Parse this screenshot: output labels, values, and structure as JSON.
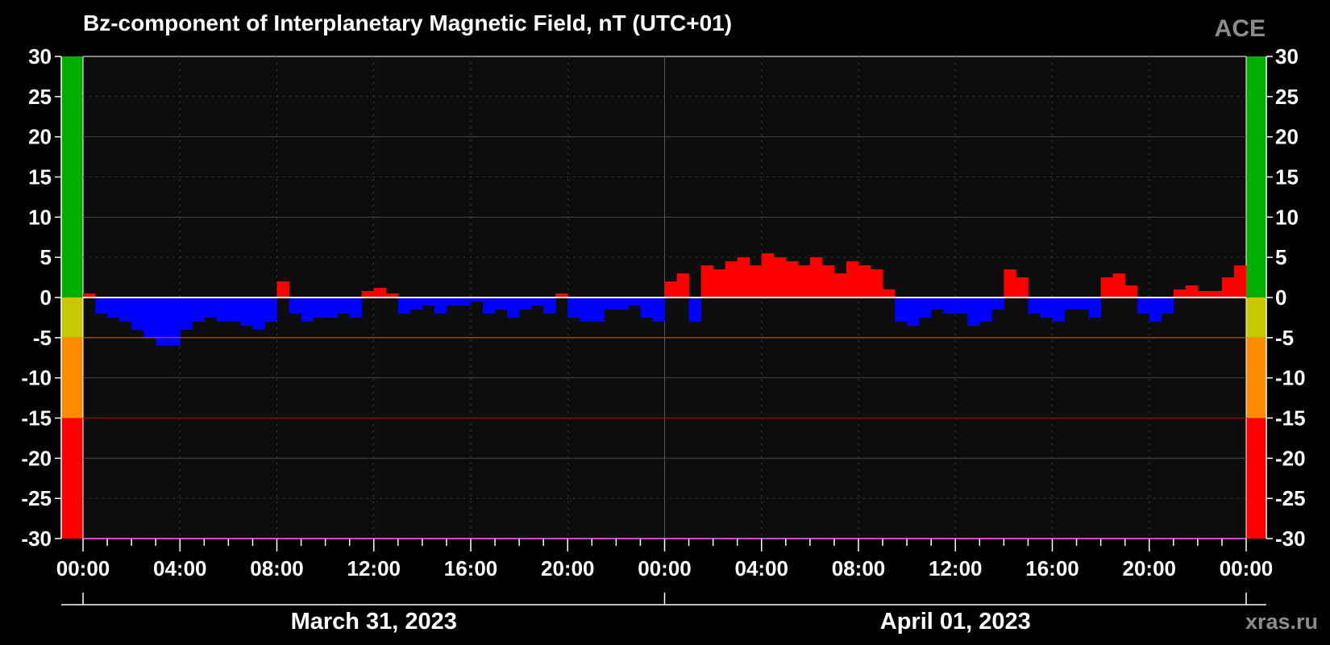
{
  "chart_data": {
    "type": "bar",
    "title": "Bz-component of Interplanetary Magnetic Field, nT (UTC+01)",
    "source_label": "ACE",
    "site_label": "xras.ru",
    "xlabel": "",
    "ylabel": "",
    "ylim": [
      -30,
      30
    ],
    "y_ticks": [
      30,
      25,
      20,
      15,
      10,
      5,
      0,
      -5,
      -10,
      -15,
      -20,
      -25,
      -30
    ],
    "x_range_hours": [
      0,
      48
    ],
    "x_ticks": [
      {
        "hour": 0,
        "label": "00:00"
      },
      {
        "hour": 4,
        "label": "04:00"
      },
      {
        "hour": 8,
        "label": "08:00"
      },
      {
        "hour": 12,
        "label": "12:00"
      },
      {
        "hour": 16,
        "label": "16:00"
      },
      {
        "hour": 20,
        "label": "20:00"
      },
      {
        "hour": 24,
        "label": "00:00"
      },
      {
        "hour": 28,
        "label": "04:00"
      },
      {
        "hour": 32,
        "label": "08:00"
      },
      {
        "hour": 36,
        "label": "12:00"
      },
      {
        "hour": 40,
        "label": "16:00"
      },
      {
        "hour": 44,
        "label": "20:00"
      },
      {
        "hour": 48,
        "label": "00:00"
      }
    ],
    "dates": [
      {
        "label": "March 31, 2023",
        "center_hour": 12
      },
      {
        "label": "April 01, 2023",
        "center_hour": 36
      }
    ],
    "grid": true,
    "threshold_bands": [
      {
        "from": 0,
        "to": 30,
        "color": "#00b000"
      },
      {
        "from": -5,
        "to": 0,
        "color": "#c8c800"
      },
      {
        "from": -15,
        "to": -5,
        "color": "#ff8c00"
      },
      {
        "from": -30,
        "to": -15,
        "color": "#ff0000"
      }
    ],
    "threshold_lines": [
      {
        "value": -5,
        "color": "#b06000"
      },
      {
        "value": -15,
        "color": "#a00000"
      }
    ],
    "colors": {
      "positive": "#ff0000",
      "negative": "#0000ff",
      "background": "#0d0d0d",
      "zero_line": "#ffffff"
    },
    "series": [
      {
        "sample_interval_hours": 0.5,
        "values": [
          0.5,
          -2.0,
          -2.5,
          -3.0,
          -4.0,
          -5.0,
          -6.0,
          -6.0,
          -4.0,
          -3.0,
          -2.5,
          -3.0,
          -3.0,
          -3.5,
          -4.0,
          -3.0,
          2.0,
          -2.0,
          -3.0,
          -2.5,
          -2.5,
          -2.0,
          -2.5,
          0.8,
          1.2,
          0.5,
          -2.0,
          -1.5,
          -1.0,
          -2.0,
          -1.0,
          -1.0,
          -0.5,
          -2.0,
          -1.5,
          -2.5,
          -1.5,
          -1.0,
          -2.0,
          0.5,
          -2.5,
          -3.0,
          -3.0,
          -1.5,
          -1.5,
          -1.0,
          -2.5,
          -3.0,
          2.0,
          3.0,
          -3.0,
          4.0,
          3.5,
          4.5,
          5.0,
          4.0,
          5.5,
          5.0,
          4.5,
          4.0,
          5.0,
          4.0,
          3.0,
          4.5,
          4.0,
          3.5,
          1.0,
          -3.0,
          -3.5,
          -2.5,
          -1.5,
          -2.0,
          -2.0,
          -3.5,
          -3.0,
          -1.5,
          3.5,
          2.5,
          -2.0,
          -2.5,
          -3.0,
          -1.5,
          -1.5,
          -2.5,
          2.5,
          3.0,
          1.5,
          -2.0,
          -3.0,
          -2.0,
          1.0,
          1.5,
          0.8,
          0.8,
          2.5,
          4.0
        ]
      }
    ]
  }
}
